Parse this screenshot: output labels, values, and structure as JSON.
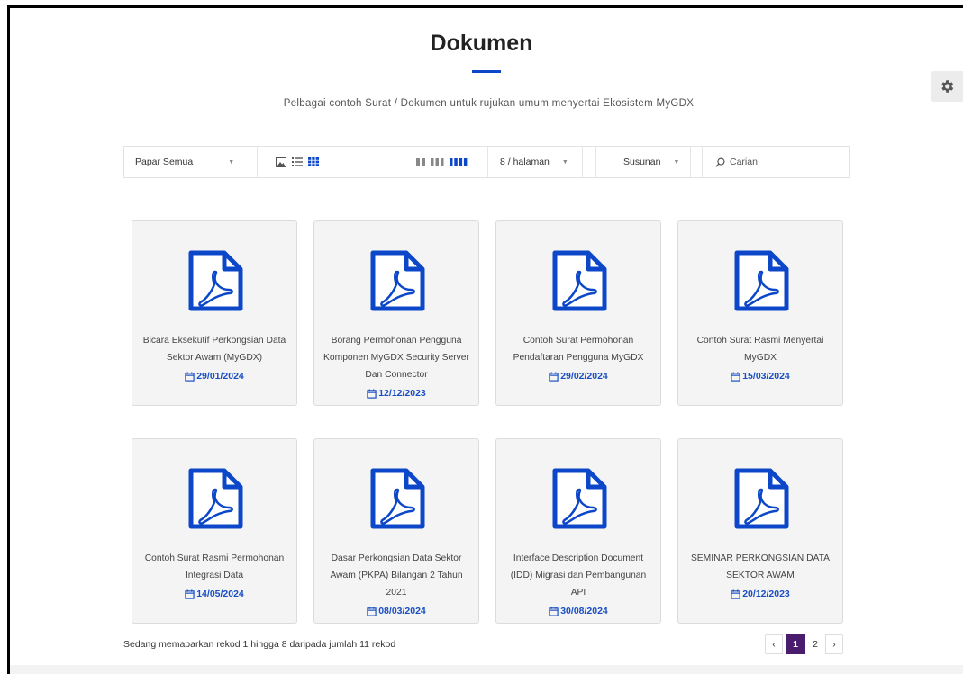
{
  "page": {
    "title": "Dokumen",
    "subtitle": "Pelbagai contoh Surat / Dokumen untuk rujukan umum menyertai Ekosistem MyGDX"
  },
  "toolbar": {
    "filter_value": "Papar Semua",
    "per_page_value": "8 / halaman",
    "sort_label": "Susunan",
    "search_placeholder": "Carian",
    "active_view": "grid",
    "active_columns": 4
  },
  "colors": {
    "accent": "#0d47c9",
    "date": "#1a4fc4",
    "pager_active": "#4a1c6d"
  },
  "documents": [
    {
      "title": "Bicara Eksekutif Perkongsian Data Sektor Awam (MyGDX)",
      "date": "29/01/2024"
    },
    {
      "title": "Borang Permohonan Pengguna Komponen MyGDX Security Server Dan Connector",
      "date": "12/12/2023"
    },
    {
      "title": "Contoh Surat Permohonan Pendaftaran Pengguna MyGDX",
      "date": "29/02/2024"
    },
    {
      "title": "Contoh Surat Rasmi Menyertai MyGDX",
      "date": "15/03/2024"
    },
    {
      "title": "Contoh Surat Rasmi Permohonan Integrasi Data",
      "date": "14/05/2024"
    },
    {
      "title": "Dasar Perkongsian Data Sektor Awam (PKPA) Bilangan 2 Tahun 2021",
      "date": "08/03/2024"
    },
    {
      "title": "Interface Description Document (IDD) Migrasi dan Pembangunan API",
      "date": "30/08/2024"
    },
    {
      "title": "SEMINAR PERKONGSIAN DATA SEKTOR AWAM",
      "date": "20/12/2023"
    }
  ],
  "footer": {
    "record_text": "Sedang memaparkan rekod 1 hingga 8 daripada jumlah 11 rekod"
  },
  "pagination": {
    "prev": "‹",
    "pages": [
      "1",
      "2"
    ],
    "current": "1",
    "next": "›"
  }
}
